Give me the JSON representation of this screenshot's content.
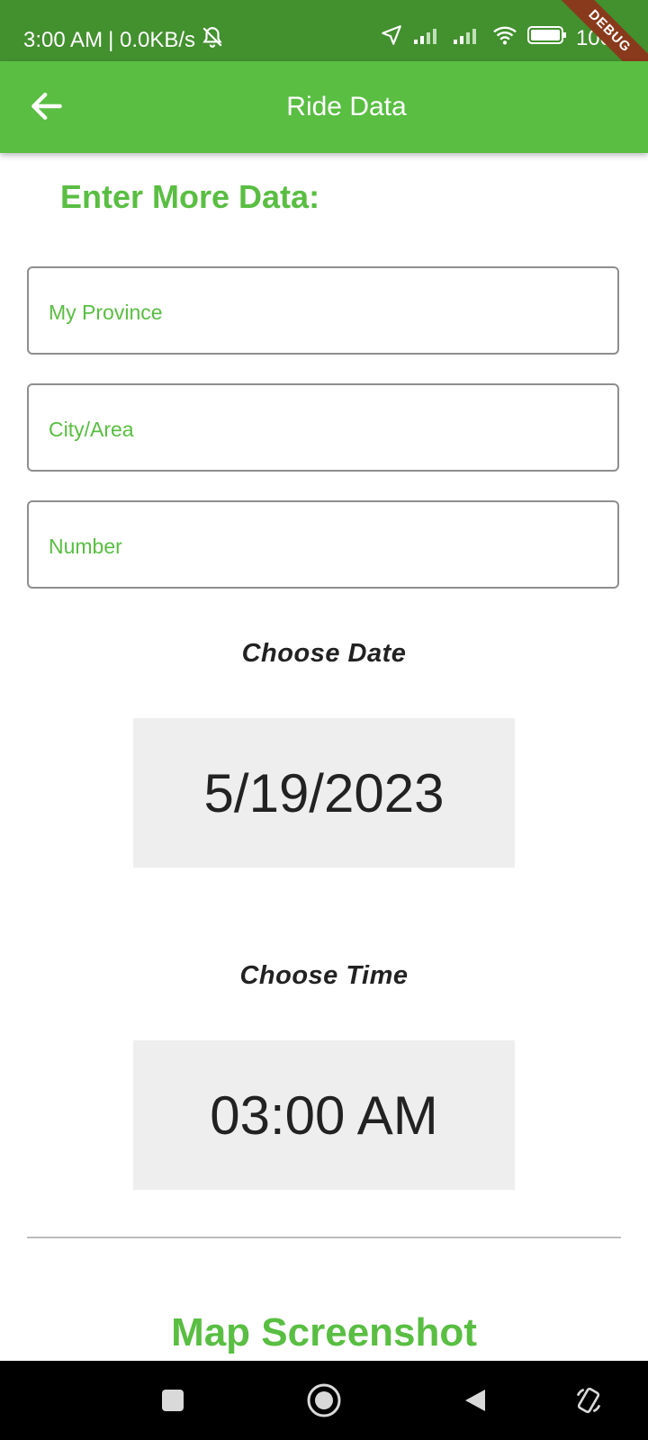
{
  "status_bar": {
    "time": "3:00 AM",
    "speed": "| 0.0KB/s",
    "battery": "100",
    "debug": "DEBUG"
  },
  "app_bar": {
    "title": "Ride Data"
  },
  "form": {
    "section_title": "Enter More Data:",
    "province_placeholder": "My Province",
    "city_placeholder": "City/Area",
    "number_placeholder": "Number"
  },
  "date": {
    "label": "Choose Date",
    "value": "5/19/2023"
  },
  "time": {
    "label": "Choose Time",
    "value": "03:00 AM"
  },
  "map": {
    "title": "Map Screenshot"
  },
  "nav": {
    "icons": [
      "square-icon",
      "home-circle-icon",
      "back-triangle-icon",
      "rotate-icon"
    ]
  },
  "colors": {
    "status_bar": "#43902f",
    "app_bar": "#59be42",
    "accent": "#59be42",
    "picker_bg": "#eeeeee"
  }
}
